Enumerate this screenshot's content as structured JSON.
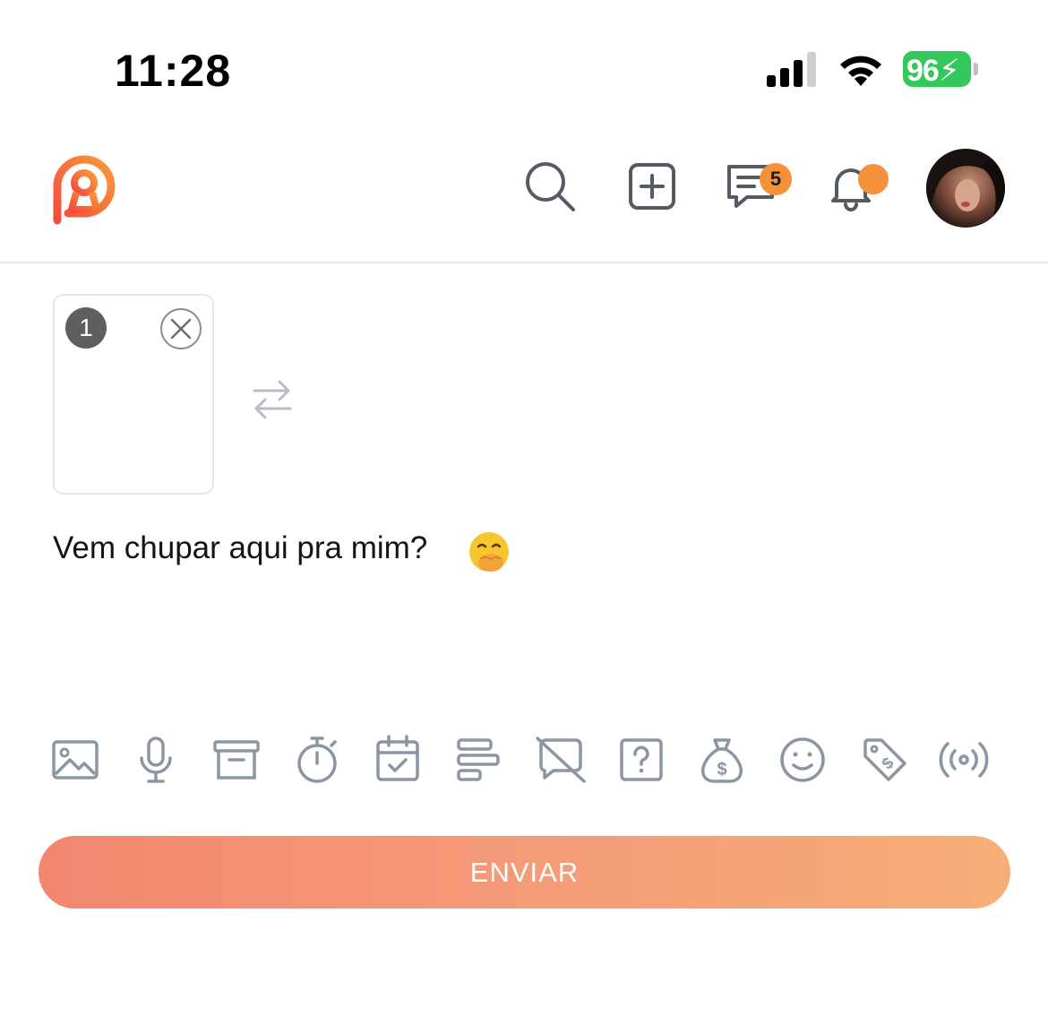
{
  "status_bar": {
    "time": "11:28",
    "battery_level": "96",
    "battery_color": "#34c759",
    "icons": [
      "signal-icon",
      "wifi-icon",
      "battery-icon"
    ]
  },
  "header": {
    "logo_icon": "keyhole-logo",
    "actions": [
      {
        "name": "search",
        "icon": "search-icon"
      },
      {
        "name": "add-post",
        "icon": "plus-square-icon"
      },
      {
        "name": "messages",
        "icon": "chat-icon",
        "badge": "5"
      },
      {
        "name": "notifications",
        "icon": "bell-icon",
        "dot": true
      },
      {
        "name": "profile",
        "icon": "avatar"
      }
    ],
    "accent_color": "#f5913a"
  },
  "composer": {
    "media": [
      {
        "index": "1"
      }
    ],
    "text": "Vem chupar aqui pra mim?",
    "emoji": "face-with-hand-over-mouth"
  },
  "toolbar": {
    "tools": [
      "image-icon",
      "microphone-icon",
      "archive-icon",
      "timer-icon",
      "calendar-check-icon",
      "text-align-icon",
      "hide-comments-icon",
      "question-icon",
      "money-bag-icon",
      "emoji-icon",
      "price-tag-icon",
      "broadcast-icon"
    ],
    "icon_color": "#8c95a3"
  },
  "send_button": {
    "label": "ENVIAR",
    "gradient": [
      "#f3876f",
      "#f6ae76"
    ]
  }
}
